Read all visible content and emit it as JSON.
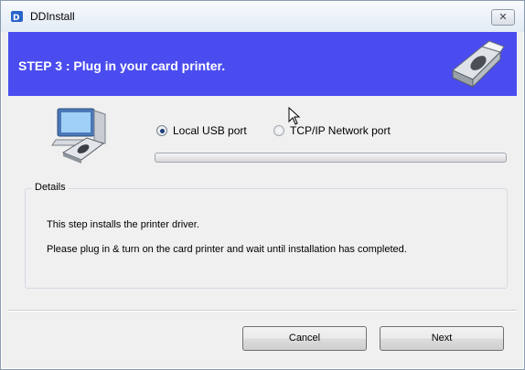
{
  "window": {
    "title": "DDInstall",
    "close_label": "✕"
  },
  "header": {
    "step_title": "STEP 3 :  Plug in your card printer."
  },
  "connection": {
    "options": [
      {
        "label": "Local USB port",
        "selected": true
      },
      {
        "label": "TCP/IP Network port",
        "selected": false
      }
    ]
  },
  "progress": {
    "value_percent": 0
  },
  "details": {
    "group_label": "Details",
    "lines": [
      "This step installs the printer driver.",
      "Please plug in & turn on the card printer and wait until installation has completed."
    ]
  },
  "buttons": {
    "cancel_label": "Cancel",
    "next_label": "Next"
  },
  "colors": {
    "banner": "#4a4cf0",
    "step_text": "#ffffff"
  },
  "icons": [
    "app-icon",
    "card-printer-icon",
    "computer-with-printer-icon",
    "mouse-cursor-icon"
  ]
}
